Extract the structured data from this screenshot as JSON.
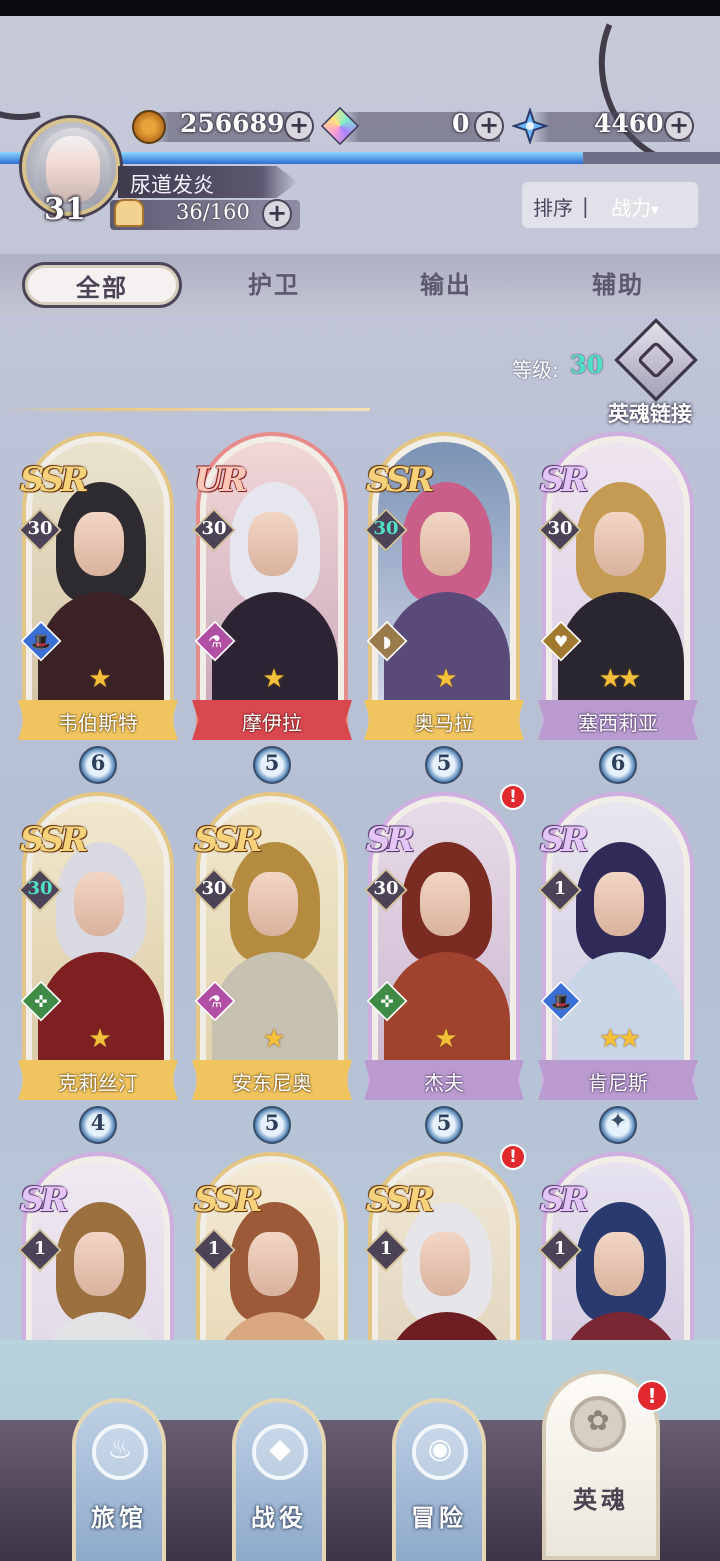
{
  "header": {
    "player_level": "31",
    "player_name": "尿道发炎",
    "stamina": "36/160",
    "xp_fraction": 0.81,
    "resources": [
      {
        "icon": "gold-coin-icon",
        "value": "256689"
      },
      {
        "icon": "rainbow-gem-icon",
        "value": "0"
      },
      {
        "icon": "blue-star-crystal-icon",
        "value": "4460"
      }
    ],
    "sort": {
      "label": "排序",
      "separator": "|",
      "value": "战力"
    }
  },
  "tabs": [
    {
      "label": "全部",
      "active": true
    },
    {
      "label": "护卫",
      "active": false
    },
    {
      "label": "输出",
      "active": false
    },
    {
      "label": "辅助",
      "active": false
    }
  ],
  "level_filter": {
    "label": "等级:",
    "value": "30"
  },
  "soul_link": {
    "label": "英魂链接"
  },
  "heroes": [
    {
      "name": "韦伯斯特",
      "rarity": "SSR",
      "level": "30",
      "stars": "★",
      "shards": "6",
      "role": "hat",
      "alert": false
    },
    {
      "name": "摩伊拉",
      "rarity": "UR",
      "level": "30",
      "stars": "★",
      "shards": "5",
      "role": "potion",
      "alert": false
    },
    {
      "name": "奥马拉",
      "rarity": "SSR",
      "level": "30",
      "stars": "★",
      "shards": "5",
      "role": "shield",
      "alert": false
    },
    {
      "name": "塞西莉亚",
      "rarity": "SR",
      "level": "30",
      "stars": "★★",
      "shards": "6",
      "role": "shield-heart",
      "alert": false
    },
    {
      "name": "克莉丝汀",
      "rarity": "SSR",
      "level": "30",
      "stars": "★",
      "shards": "4",
      "role": "crosshair",
      "alert": false
    },
    {
      "name": "安东尼奥",
      "rarity": "SSR",
      "level": "30",
      "stars": "★",
      "shards": "5",
      "role": "potion",
      "alert": false
    },
    {
      "name": "杰夫",
      "rarity": "SR",
      "level": "30",
      "stars": "★",
      "shards": "5",
      "role": "crosshair",
      "alert": true
    },
    {
      "name": "肯尼斯",
      "rarity": "SR",
      "level": "1",
      "stars": "★★",
      "shards": "",
      "role": "hat",
      "alert": false
    },
    {
      "name": "",
      "rarity": "SR",
      "level": "1",
      "stars": "",
      "shards": "",
      "role": "",
      "alert": false
    },
    {
      "name": "",
      "rarity": "SSR",
      "level": "1",
      "stars": "",
      "shards": "",
      "role": "",
      "alert": false
    },
    {
      "name": "",
      "rarity": "SSR",
      "level": "1",
      "stars": "",
      "shards": "",
      "role": "",
      "alert": true
    },
    {
      "name": "",
      "rarity": "SR",
      "level": "1",
      "stars": "",
      "shards": "",
      "role": "",
      "alert": false
    }
  ],
  "nav": [
    {
      "label": "旅馆",
      "icon": "tavern-mug-icon",
      "active": false
    },
    {
      "label": "战役",
      "icon": "campaign-crest-icon",
      "active": false
    },
    {
      "label": "冒险",
      "icon": "adventure-eye-icon",
      "active": false
    },
    {
      "label": "英魂",
      "icon": "hero-soul-icon",
      "active": true,
      "alert": true
    }
  ],
  "colors": {
    "accent_gold": "#f0c45e",
    "accent_purple": "#b99bd0",
    "accent_red": "#d9484f",
    "max_level_teal": "#4fe0c7",
    "alert_red": "#e0282d"
  }
}
